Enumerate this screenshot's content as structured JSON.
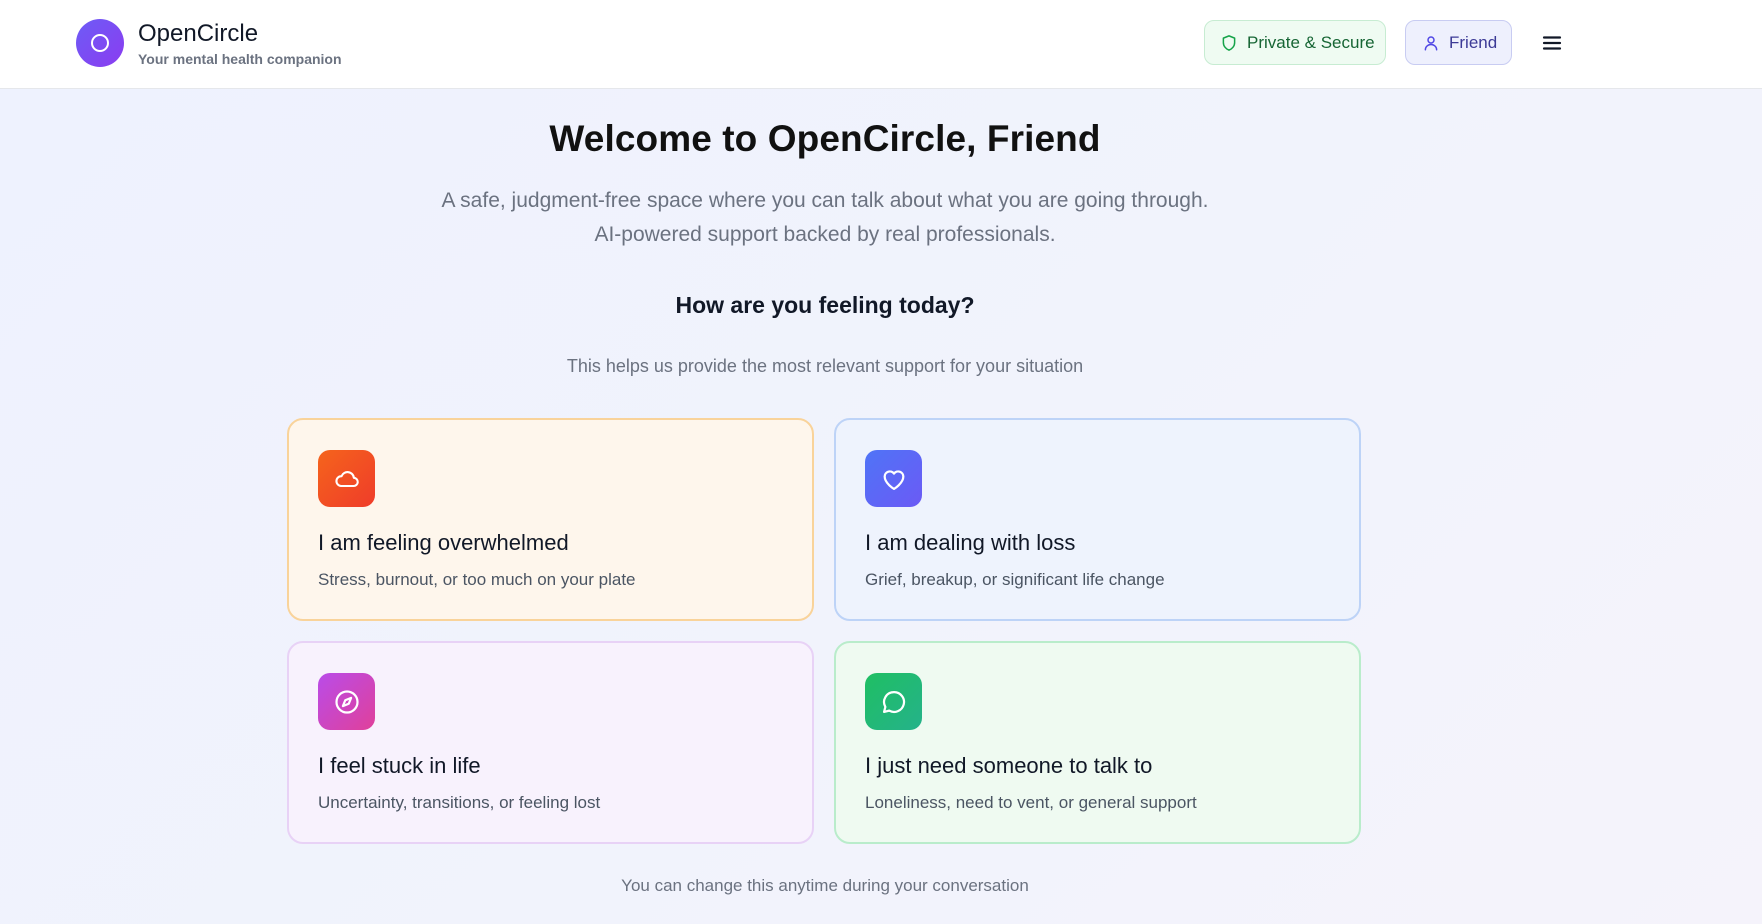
{
  "app": {
    "name": "OpenCircle",
    "tagline": "Your mental health companion"
  },
  "header": {
    "secure_label": "Private & Secure",
    "user_label": "Friend",
    "menu_icon": "hamburger-menu-icon"
  },
  "hero": {
    "title": "Welcome to OpenCircle, Friend",
    "subtitle_line1": "A safe, judgment-free space where you can talk about what you are going through.",
    "subtitle_line2": "AI-powered support backed by real professionals."
  },
  "mood": {
    "question": "How are you feeling today?",
    "helper": "This helps us provide the most relevant support for your situation",
    "options": [
      {
        "icon": "cloud-icon",
        "title": "I am feeling overwhelmed",
        "description": "Stress, burnout, or too much on your plate",
        "accent": "#f5641c"
      },
      {
        "icon": "heart-icon",
        "title": "I am dealing with loss",
        "description": "Grief, breakup, or significant life change",
        "accent": "#5b68f6"
      },
      {
        "icon": "compass-icon",
        "title": "I feel stuck in life",
        "description": "Uncertainty, transitions, or feeling lost",
        "accent": "#c947d6"
      },
      {
        "icon": "chat-bubble-icon",
        "title": "I just need someone to talk to",
        "description": "Loneliness, need to vent, or general support",
        "accent": "#22b874"
      }
    ],
    "footnote": "You can change this anytime during your conversation"
  }
}
